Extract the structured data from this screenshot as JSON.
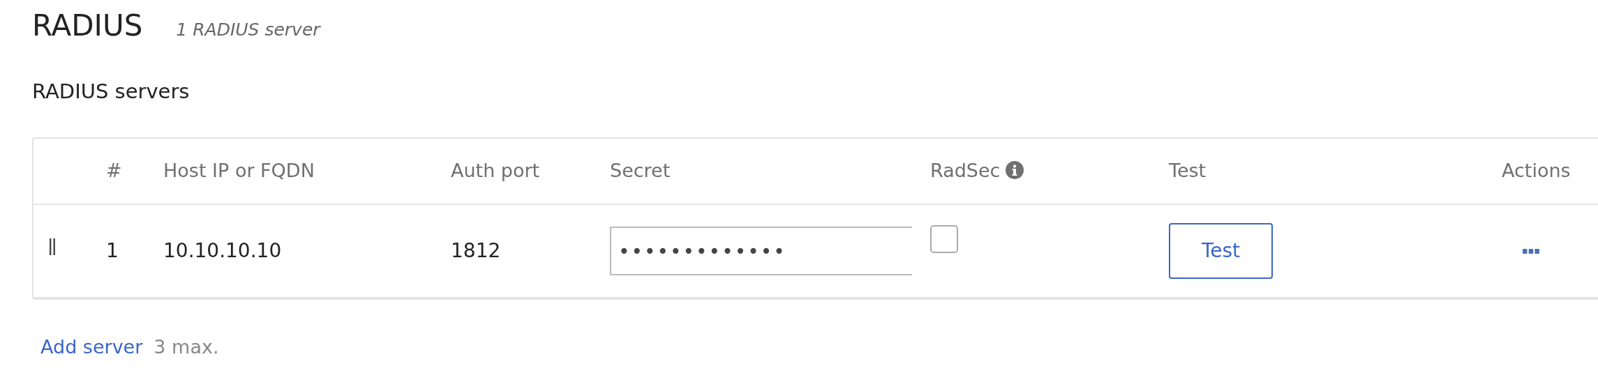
{
  "header": {
    "title": "RADIUS",
    "subtitle": "1 RADIUS server"
  },
  "section_title": "RADIUS servers",
  "table": {
    "columns": [
      "",
      "#",
      "Host IP or FQDN",
      "Auth port",
      "Secret",
      "RadSec",
      "Test",
      "Actions"
    ],
    "rows": [
      {
        "index": "1",
        "host": "10.10.10.10",
        "auth_port": "1812",
        "secret": "•••••••••••••",
        "radsec": false,
        "test_button": "Test"
      }
    ]
  },
  "add_link": "Add server",
  "add_limit": "3 max."
}
